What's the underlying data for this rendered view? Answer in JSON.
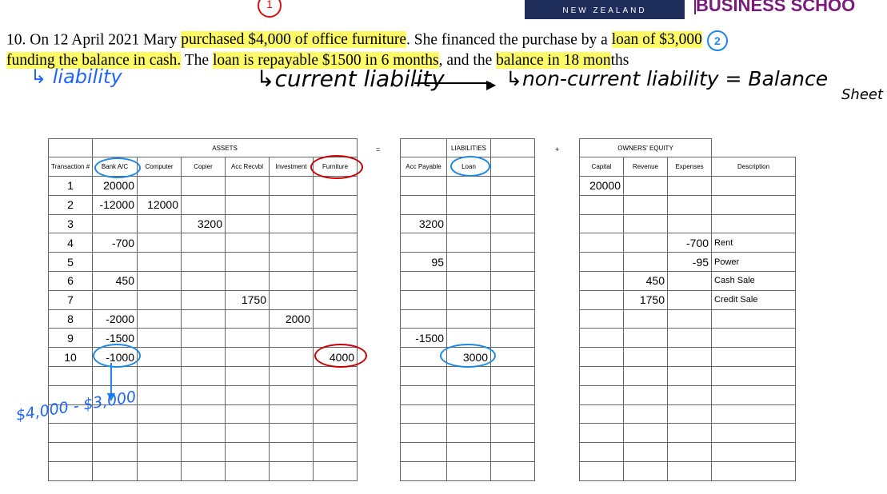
{
  "header": {
    "marker": "1",
    "logo_text": "NEW ZEALAND",
    "school": "BUSINESS SCHOO"
  },
  "question": {
    "t1": "10. On 12 April 2021 Mary ",
    "h1": "purchased $4,000 of office furniture",
    "t2": ". She financed the purchase by a ",
    "h2": "loan of $3,000",
    "marker2": "2",
    "h3": "funding the balance in cash.",
    "t3": " The ",
    "h4": "loan is repayable $1500 in 6 months",
    "t4": ", and the ",
    "h5": "balance in 18 mon",
    "t5": "ths"
  },
  "annotations": {
    "liability": "↳ liability",
    "current": "↳current liability",
    "noncurrent": "↳non-current liability = Balance",
    "sheet": "Sheet",
    "calc": "$4,000 - $3,000"
  },
  "assets": {
    "group": "ASSETS",
    "headers": [
      "Transaction #",
      "Bank A/C",
      "Computer",
      "Copier",
      "Acc Recvbl",
      "Investment",
      "Furniture",
      ""
    ],
    "rows": [
      [
        "1",
        "20000",
        "",
        "",
        "",
        "",
        "",
        ""
      ],
      [
        "2",
        "-12000",
        "12000",
        "",
        "",
        "",
        "",
        ""
      ],
      [
        "3",
        "",
        "",
        "3200",
        "",
        "",
        "",
        ""
      ],
      [
        "4",
        "-700",
        "",
        "",
        "",
        "",
        "",
        ""
      ],
      [
        "5",
        "",
        "",
        "",
        "",
        "",
        "",
        ""
      ],
      [
        "6",
        "450",
        "",
        "",
        "",
        "",
        "",
        ""
      ],
      [
        "7",
        "",
        "",
        "",
        "1750",
        "",
        "",
        ""
      ],
      [
        "8",
        "-2000",
        "",
        "",
        "",
        "2000",
        "",
        ""
      ],
      [
        "9",
        "-1500",
        "",
        "",
        "",
        "",
        "",
        ""
      ],
      [
        "10",
        "-1000",
        "",
        "",
        "",
        "",
        "4000",
        ""
      ],
      [
        "",
        "",
        "",
        "",
        "",
        "",
        "",
        ""
      ],
      [
        "",
        "",
        "",
        "",
        "",
        "",
        "",
        ""
      ],
      [
        "",
        "",
        "",
        "",
        "",
        "",
        "",
        ""
      ],
      [
        "",
        "",
        "",
        "",
        "",
        "",
        "",
        ""
      ],
      [
        "",
        "",
        "",
        "",
        "",
        "",
        "",
        ""
      ],
      [
        "",
        "",
        "",
        "",
        "",
        "",
        "",
        ""
      ]
    ]
  },
  "eq_sign": "=",
  "plus_sign": "+",
  "liabilities": {
    "group": "LIABILITIES",
    "headers": [
      "Acc Payable",
      "Loan",
      ""
    ],
    "rows": [
      [
        "",
        "",
        ""
      ],
      [
        "",
        "",
        ""
      ],
      [
        "3200",
        "",
        ""
      ],
      [
        "",
        "",
        ""
      ],
      [
        "95",
        "",
        ""
      ],
      [
        "",
        "",
        ""
      ],
      [
        "",
        "",
        ""
      ],
      [
        "",
        "",
        ""
      ],
      [
        "-1500",
        "",
        ""
      ],
      [
        "",
        "3000",
        ""
      ],
      [
        "",
        "",
        ""
      ],
      [
        "",
        "",
        ""
      ],
      [
        "",
        "",
        ""
      ],
      [
        "",
        "",
        ""
      ],
      [
        "",
        "",
        ""
      ],
      [
        "",
        "",
        ""
      ]
    ]
  },
  "equity": {
    "group": "OWNERS' EQUITY",
    "headers": [
      "Capital",
      "Revenue",
      "Expenses",
      "Description"
    ],
    "rows": [
      [
        "20000",
        "",
        "",
        ""
      ],
      [
        "",
        "",
        "",
        ""
      ],
      [
        "",
        "",
        "",
        ""
      ],
      [
        "",
        "",
        "-700",
        "Rent"
      ],
      [
        "",
        "",
        "-95",
        "Power"
      ],
      [
        "",
        "450",
        "",
        "Cash Sale"
      ],
      [
        "",
        "1750",
        "",
        "Credit Sale"
      ],
      [
        "",
        "",
        "",
        ""
      ],
      [
        "",
        "",
        "",
        ""
      ],
      [
        "",
        "",
        "",
        ""
      ],
      [
        "",
        "",
        "",
        ""
      ],
      [
        "",
        "",
        "",
        ""
      ],
      [
        "",
        "",
        "",
        ""
      ],
      [
        "",
        "",
        "",
        ""
      ],
      [
        "",
        "",
        "",
        ""
      ],
      [
        "",
        "",
        "",
        ""
      ]
    ]
  }
}
